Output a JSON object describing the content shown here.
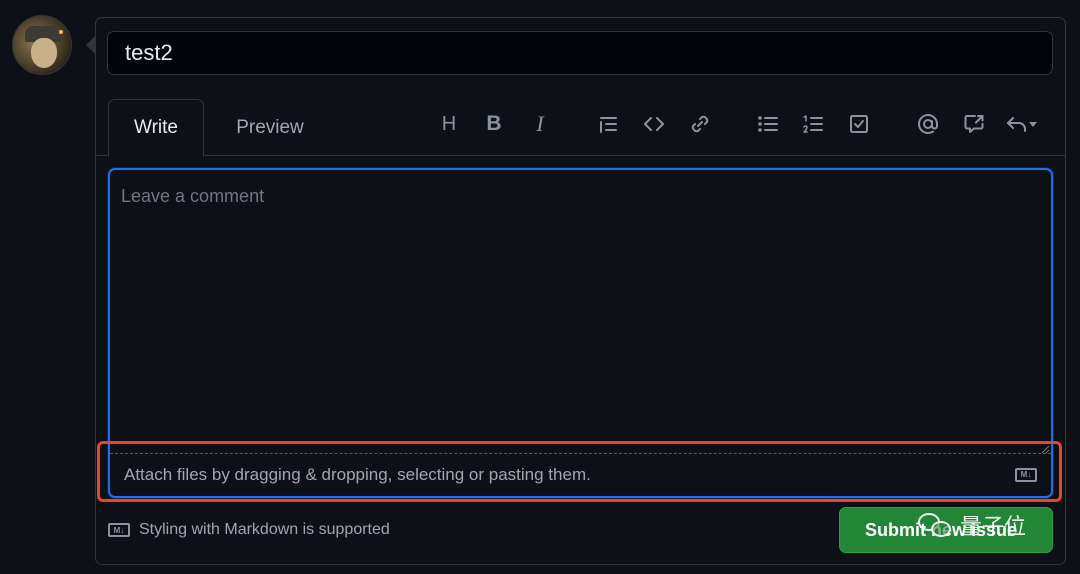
{
  "issue": {
    "title_value": "test2"
  },
  "tabs": [
    {
      "label": "Write",
      "active": true
    },
    {
      "label": "Preview",
      "active": false
    }
  ],
  "toolbar": {
    "icons": [
      "heading-icon",
      "bold-icon",
      "italic-icon",
      "quote-icon",
      "code-icon",
      "link-icon",
      "unordered-list-icon",
      "ordered-list-icon",
      "task-list-icon",
      "mention-icon",
      "reference-icon",
      "saved-replies-icon"
    ],
    "heading_glyph": "H",
    "bold_glyph": "B",
    "italic_glyph": "I"
  },
  "comment": {
    "placeholder": "Leave a comment",
    "value": "",
    "attach_text": "Attach files by dragging & dropping, selecting or pasting them.",
    "md_badge": "M↓"
  },
  "footer": {
    "markdown_note": "Styling with Markdown is supported",
    "md_badge": "M↓",
    "submit_label": "Submit new issue"
  },
  "watermark": {
    "text": "量子位"
  },
  "colors": {
    "background": "#0d1117",
    "border": "#30363d",
    "focus": "#1f6feb",
    "submit": "#238636",
    "highlight": "#e8442e"
  }
}
